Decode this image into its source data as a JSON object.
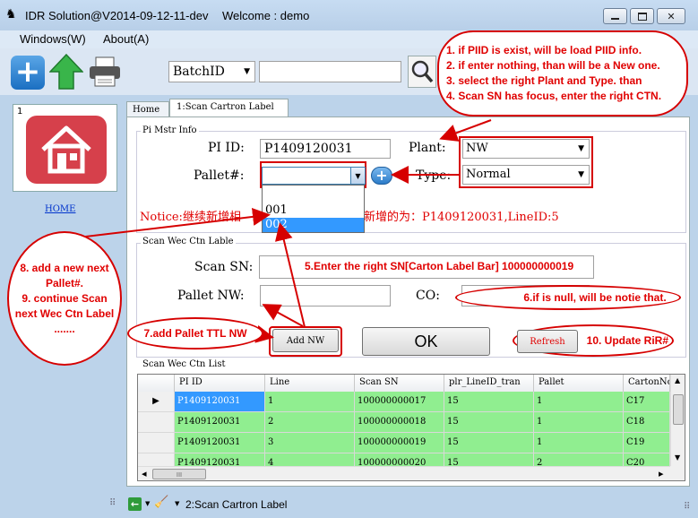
{
  "window": {
    "title": "IDR Solution@V2014-09-12-11-dev",
    "welcome": "Welcome : demo"
  },
  "menu": [
    "Windows(W)",
    "About(A)"
  ],
  "toolbar": {
    "batch_select": "BatchID",
    "batch_input": ""
  },
  "sidebar": {
    "number": "1",
    "home_link": "HOME"
  },
  "tabs": [
    "Home",
    "1:Scan Cartron Label"
  ],
  "mstr": {
    "group": "Pi Mstr Info",
    "pi_label": "PI ID:",
    "pi_value": "P1409120031",
    "plant_label": "Plant:",
    "plant_value": "NW",
    "pallet_label": "Pallet#:",
    "pallet_value": "",
    "pallet_options": [
      "001",
      "002"
    ],
    "type_label": "Type:",
    "type_value": "Normal",
    "notice": "Notice:继续新增相",
    "notice_tail": "新增的为：P1409120031,LineID:5"
  },
  "scan": {
    "group": "Scan Wec Ctn Lable",
    "sn_label": "Scan SN:",
    "nw_label": "Pallet NW:",
    "co_label": "CO:",
    "nw_value": "",
    "co_value": "",
    "add_nw": "Add NW",
    "ok": "OK",
    "refresh": "Refresh"
  },
  "list": {
    "group": "Scan Wec Ctn List",
    "columns": [
      "PI ID",
      "Line",
      "Scan SN",
      "plr_LineID_tran",
      "Pallet",
      "CartonNo"
    ],
    "rows": [
      [
        "P1409120031",
        "1",
        "100000000017",
        "15",
        "1",
        "C17"
      ],
      [
        "P1409120031",
        "2",
        "100000000018",
        "15",
        "1",
        "C18"
      ],
      [
        "P1409120031",
        "3",
        "100000000019",
        "15",
        "1",
        "C19"
      ],
      [
        "P1409120031",
        "4",
        "100000000020",
        "15",
        "2",
        "C20"
      ]
    ],
    "scroll_left": "◂",
    "scroll_right": "▸",
    "scroll_grip": "III"
  },
  "callouts": {
    "tips": [
      "1. if PIID is exist, will be load PIID info.",
      "2. if enter nothing, than will be a New one.",
      "3. select the right Plant and Type. than",
      "4. Scan SN has focus, enter the right CTN."
    ],
    "c5": "5.Enter the right SN[Carton Label Bar] 100000000019",
    "c6": "6.if is null, will be notie  that.",
    "c7": "7.add Pallet TTL NW",
    "c8": "8. add a new next Pallet#.\n9. continue Scan next Wec Ctn Label\n.......",
    "c10": "10. Update RiR#"
  },
  "statusbar": {
    "tab": "2:Scan Cartron Label"
  },
  "colors": {
    "accent_red": "#d60000",
    "row_green": "#90ee90",
    "selected_blue": "#3399ff",
    "home_tile": "#d6404b"
  }
}
